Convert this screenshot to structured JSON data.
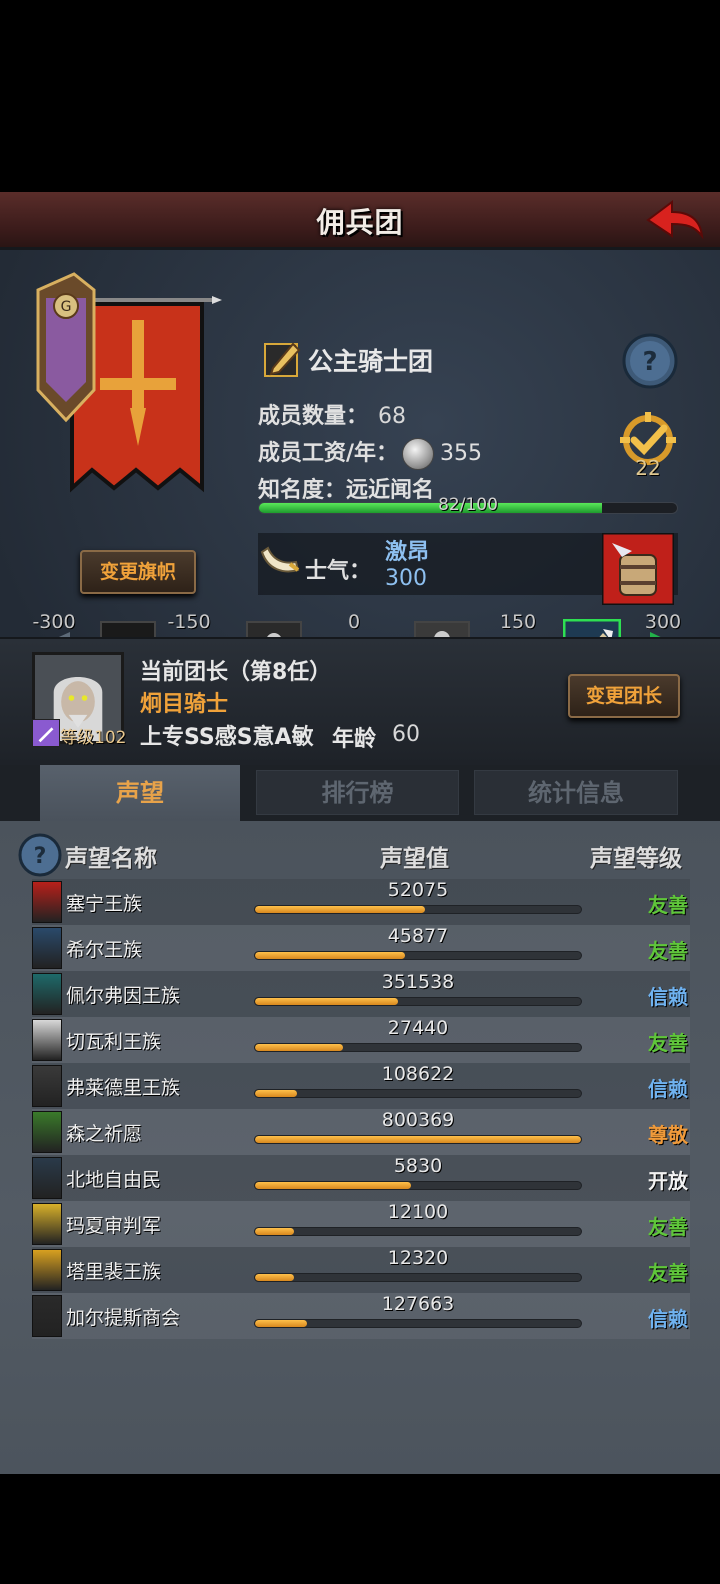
{
  "header": {
    "title": "佣兵团"
  },
  "guild": {
    "name": "公主骑士团",
    "members_label": "成员数量：",
    "members_value": "68",
    "wage_label": "成员工资/年：",
    "wage_value": "355",
    "fame_label": "知名度：远近闻名",
    "fame_progress_text": "82/100",
    "fame_progress": 0.82,
    "change_flag_label": "变更旗帜",
    "task_count": "22"
  },
  "morale": {
    "label": "士气：",
    "state": "激昂",
    "value": "300",
    "scale_ticks": [
      "-300",
      "-150",
      "0",
      "150",
      "300"
    ]
  },
  "leader": {
    "title": "当前团长（第8任）",
    "name": "炯目骑士",
    "level_text": "等级102",
    "attributes": "上专SS感S意A敏",
    "age_label": "年龄",
    "age_value": "60",
    "change_label": "变更团长"
  },
  "tabs": [
    "声望",
    "排行榜",
    "统计信息"
  ],
  "reputation": {
    "headers": {
      "name": "声望名称",
      "value": "声望值",
      "level": "声望等级"
    },
    "colors": {
      "friendly": "#5fc63a",
      "trusted": "#6fb2f0",
      "respected": "#f09a3a",
      "neutral": "#f2f2f2"
    },
    "rows": [
      {
        "name": "塞宁王族",
        "value": "52075",
        "level": "友善",
        "tone": "friendly",
        "progress": 0.52,
        "icon": "red-shield-icon"
      },
      {
        "name": "希尔王族",
        "value": "45877",
        "level": "友善",
        "tone": "friendly",
        "progress": 0.46,
        "icon": "blue-crest-icon"
      },
      {
        "name": "佩尔弗因王族",
        "value": "351538",
        "level": "信赖",
        "tone": "trusted",
        "progress": 0.44,
        "icon": "teal-wave-icon"
      },
      {
        "name": "切瓦利王族",
        "value": "27440",
        "level": "友善",
        "tone": "friendly",
        "progress": 0.27,
        "icon": "scales-icon"
      },
      {
        "name": "弗莱德里王族",
        "value": "108622",
        "level": "信赖",
        "tone": "trusted",
        "progress": 0.13,
        "icon": "skull-icon"
      },
      {
        "name": "森之祈愿",
        "value": "800369",
        "level": "尊敬",
        "tone": "respected",
        "progress": 1.0,
        "icon": "tree-icon"
      },
      {
        "name": "北地自由民",
        "value": "5830",
        "level": "开放",
        "tone": "neutral",
        "progress": 0.48,
        "icon": "axe-icon"
      },
      {
        "name": "玛夏审判军",
        "value": "12100",
        "level": "友善",
        "tone": "friendly",
        "progress": 0.12,
        "icon": "sun-sword-icon"
      },
      {
        "name": "塔里裴王族",
        "value": "12320",
        "level": "友善",
        "tone": "friendly",
        "progress": 0.12,
        "icon": "gold-crown-icon"
      },
      {
        "name": "加尔提斯商会",
        "value": "127663",
        "level": "信赖",
        "tone": "trusted",
        "progress": 0.16,
        "icon": "chest-icon"
      }
    ]
  }
}
